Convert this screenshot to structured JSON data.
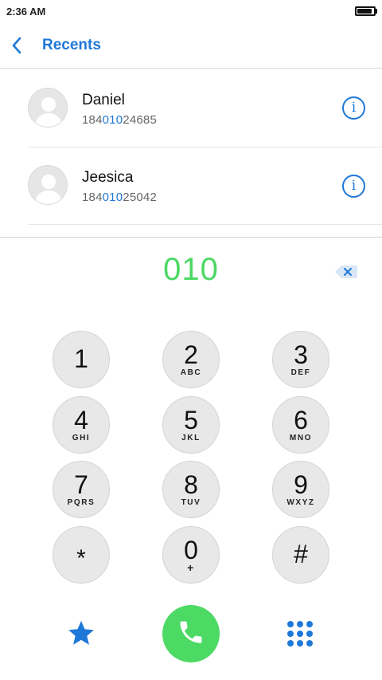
{
  "status_bar": {
    "time": "2:36 AM",
    "battery_level": 0.9
  },
  "nav": {
    "back_label": "Recents"
  },
  "recents": [
    {
      "name": "Daniel",
      "number_prefix": "184",
      "number_match": "010",
      "number_suffix": "24685"
    },
    {
      "name": "Jeesica",
      "number_prefix": "184",
      "number_match": "010",
      "number_suffix": "25042"
    }
  ],
  "dialer": {
    "display": "010",
    "keys": [
      {
        "digit": "1",
        "letters": ""
      },
      {
        "digit": "2",
        "letters": "ABC"
      },
      {
        "digit": "3",
        "letters": "DEF"
      },
      {
        "digit": "4",
        "letters": "GHI"
      },
      {
        "digit": "5",
        "letters": "JKL"
      },
      {
        "digit": "6",
        "letters": "MNO"
      },
      {
        "digit": "7",
        "letters": "PQRS"
      },
      {
        "digit": "8",
        "letters": "TUV"
      },
      {
        "digit": "9",
        "letters": "WXYZ"
      },
      {
        "digit": "*",
        "letters": ""
      },
      {
        "digit": "0",
        "letters": "+"
      },
      {
        "digit": "#",
        "letters": ""
      }
    ]
  },
  "colors": {
    "accent": "#1e78d8",
    "call_green": "#4cd964"
  },
  "icons": {
    "back": "chevron-left-icon",
    "info": "info-circle-icon",
    "delete": "backspace-icon",
    "favorites": "star-icon",
    "call": "phone-icon",
    "keypad": "keypad-grid-icon"
  }
}
